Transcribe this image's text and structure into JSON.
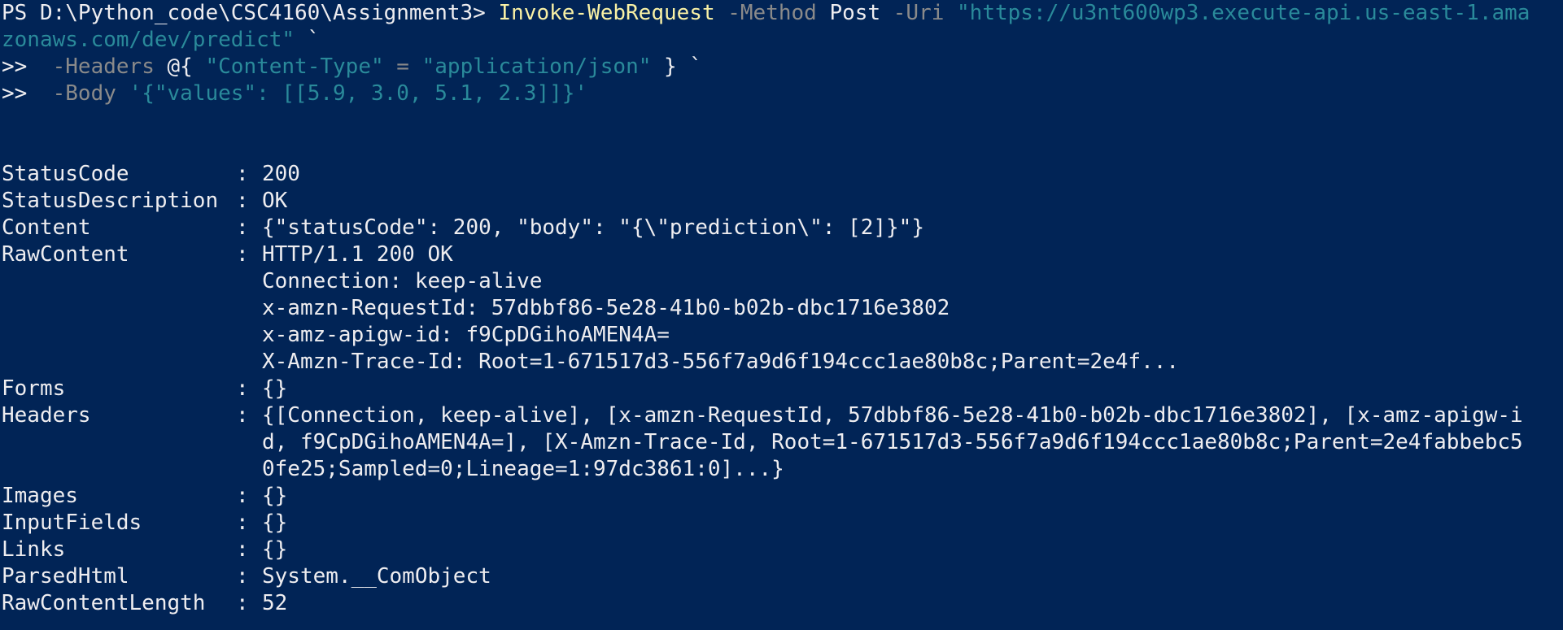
{
  "terminal": {
    "prompt": "PS D:\\Python_code\\CSC4160\\Assignment3> ",
    "command": {
      "cmdlet": "Invoke-WebRequest",
      "method_flag": " -Method ",
      "method_value": "Post",
      "uri_flag": " -Uri ",
      "uri_part1": "\"https://u3nt600wp3.execute-api.us-east-1.ama",
      "uri_part2": "zonaws.com/dev/predict\"",
      "uri_tail": " `",
      "cont_prompt_1": ">>  ",
      "headers_flag": "-Headers ",
      "headers_open": "@{ ",
      "headers_key": "\"Content-Type\"",
      "headers_eq": " = ",
      "headers_val": "\"application/json\"",
      "headers_close": " } `",
      "cont_prompt_2": ">>  ",
      "body_flag": "-Body ",
      "body_value": "'{\"values\": [[5.9, 3.0, 5.1, 2.3]]}'"
    },
    "separator": ":",
    "output": {
      "StatusCode": {
        "label": "StatusCode",
        "value": "200"
      },
      "StatusDescription": {
        "label": "StatusDescription",
        "value": "OK"
      },
      "Content": {
        "label": "Content",
        "value": "{\"statusCode\": 200, \"body\": \"{\\\"prediction\\\": [2]}\"}"
      },
      "RawContent": {
        "label": "RawContent",
        "lines": [
          "HTTP/1.1 200 OK",
          "Connection: keep-alive",
          "x-amzn-RequestId: 57dbbf86-5e28-41b0-b02b-dbc1716e3802",
          "x-amz-apigw-id: f9CpDGihoAMEN4A=",
          "X-Amzn-Trace-Id: Root=1-671517d3-556f7a9d6f194ccc1ae80b8c;Parent=2e4f..."
        ]
      },
      "Forms": {
        "label": "Forms",
        "value": "{}"
      },
      "Headers": {
        "label": "Headers",
        "lines": [
          "{[Connection, keep-alive], [x-amzn-RequestId, 57dbbf86-5e28-41b0-b02b-dbc1716e3802], [x-amz-apigw-i",
          "d, f9CpDGihoAMEN4A=], [X-Amzn-Trace-Id, Root=1-671517d3-556f7a9d6f194ccc1ae80b8c;Parent=2e4fabbebc5",
          "0fe25;Sampled=0;Lineage=1:97dc3861:0]...}"
        ]
      },
      "Images": {
        "label": "Images",
        "value": "{}"
      },
      "InputFields": {
        "label": "InputFields",
        "value": "{}"
      },
      "Links": {
        "label": "Links",
        "value": "{}"
      },
      "ParsedHtml": {
        "label": "ParsedHtml",
        "value": "System.__ComObject"
      },
      "RawContentLength": {
        "label": "RawContentLength",
        "value": "52"
      }
    }
  },
  "colors": {
    "background": "#012456",
    "foreground": "#eeedf0",
    "cmdlet": "#f9f1a5",
    "parameter": "#8a8a8a",
    "string": "#2a8a9a"
  }
}
